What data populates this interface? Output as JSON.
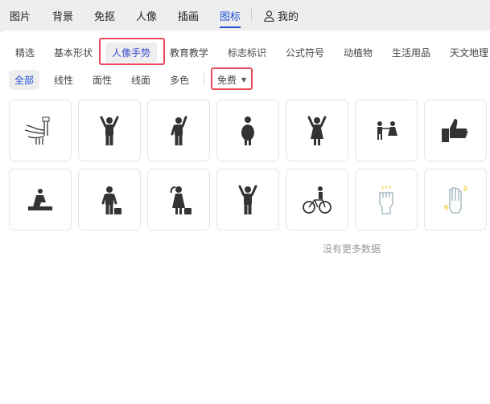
{
  "top_nav": {
    "items": [
      {
        "label": "图片"
      },
      {
        "label": "背景"
      },
      {
        "label": "免抠"
      },
      {
        "label": "人像"
      },
      {
        "label": "插画"
      },
      {
        "label": "图标",
        "active": true
      }
    ],
    "mine_label": "我的"
  },
  "categories": [
    {
      "label": "精选"
    },
    {
      "label": "基本形状"
    },
    {
      "label": "人像手势",
      "selected": true
    },
    {
      "label": "教育教学"
    },
    {
      "label": "标志标识"
    },
    {
      "label": "公式符号"
    },
    {
      "label": "动植物"
    },
    {
      "label": "生活用品"
    },
    {
      "label": "天文地理"
    }
  ],
  "styles": [
    {
      "label": "全部",
      "selected": true
    },
    {
      "label": "线性"
    },
    {
      "label": "面性"
    },
    {
      "label": "线面"
    },
    {
      "label": "多色"
    }
  ],
  "price_filter": {
    "value": "免费"
  },
  "icons": [
    "hand-washing-icon",
    "person-arms-up-icon",
    "person-waving-icon",
    "woman-standing-icon",
    "woman-arms-up-icon",
    "boy-girl-icon",
    "thumbs-up-icon",
    "person-meditating-icon",
    "man-briefcase-icon",
    "girl-briefcase-icon",
    "person-cheering-icon",
    "cyclist-icon",
    "raised-fist-icon",
    "waving-hand-icon"
  ],
  "colors": {
    "accent": "#2250d8",
    "highlight": "#ee4a5c",
    "icon": "#333333",
    "multicolor_outline": "#a8bcc4",
    "multicolor_accent": "#f2cf3a"
  },
  "footer": {
    "no_more": "没有更多数据"
  }
}
